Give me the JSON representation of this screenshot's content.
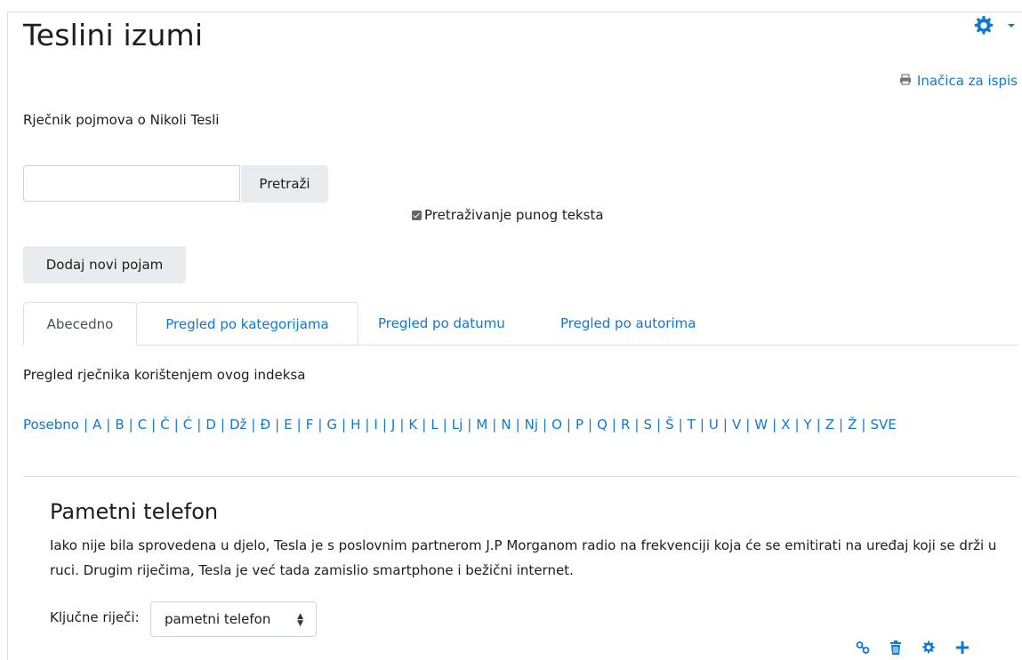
{
  "glossary": {
    "title": "Teslini izumi",
    "print_label": "Inačica za ispis",
    "intro": "Rječnik pojmova o Nikoli Tesli"
  },
  "search": {
    "value": "",
    "placeholder": "",
    "button_label": "Pretraži",
    "fulltext_label": "Pretraživanje punog teksta",
    "fulltext_checked": true
  },
  "add_entry_label": "Dodaj novi pojam",
  "tabs": [
    {
      "label": "Abecedno",
      "active": true
    },
    {
      "label": "Pregled po kategorijama",
      "active": false
    },
    {
      "label": "Pregled po datumu",
      "active": false
    },
    {
      "label": "Pregled po autorima",
      "active": false
    }
  ],
  "browse_text": "Pregled rječnika korištenjem ovog indeksa",
  "letters": [
    "Posebno",
    "A",
    "B",
    "C",
    "Č",
    "Ć",
    "D",
    "Dž",
    "Đ",
    "E",
    "F",
    "G",
    "H",
    "I",
    "J",
    "K",
    "L",
    "Lj",
    "M",
    "N",
    "Nj",
    "O",
    "P",
    "Q",
    "R",
    "S",
    "Š",
    "T",
    "U",
    "V",
    "W",
    "X",
    "Y",
    "Z",
    "Ž",
    "SVE"
  ],
  "entry": {
    "title": "Pametni telefon",
    "text": "Iako nije bila sprovedena u djelo, Tesla je s poslovnim partnerom J.P Morganom radio na frekvenciji koja će se emitirati na uređaj koji se drži u ruci. Drugim riječima, Tesla je već tada zamislio smartphone i bežični internet.",
    "keywords_label": "Ključne riječi:",
    "keyword_selected": "pametni telefon"
  },
  "icons": {
    "gear": "gear-icon",
    "printer": "printer-icon",
    "link": "link-icon",
    "delete": "trash-icon",
    "edit": "gear-icon",
    "add": "plus-icon"
  },
  "colors": {
    "link": "#1177d1",
    "text": "#1d1d1d",
    "button_bg": "#e9ecef",
    "border": "#dee2e6",
    "icon": "#1177d1"
  }
}
